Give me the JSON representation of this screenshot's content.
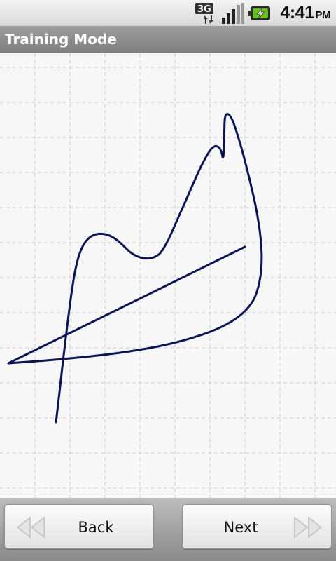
{
  "status_bar": {
    "network_label": "3G",
    "time": "4:41",
    "ampm": "PM",
    "icons": [
      "network-3g-icon",
      "signal-strength-icon",
      "battery-charging-icon"
    ]
  },
  "title_bar": {
    "title": "Training Mode"
  },
  "canvas": {
    "background_color": "#f7f7f7",
    "grid_color": "#c8c8c8",
    "stroke_color": "#0b1454"
  },
  "buttons": {
    "back_label": "Back",
    "next_label": "Next",
    "back_icon": "rewind-arrows-icon",
    "next_icon": "forward-arrows-icon"
  }
}
